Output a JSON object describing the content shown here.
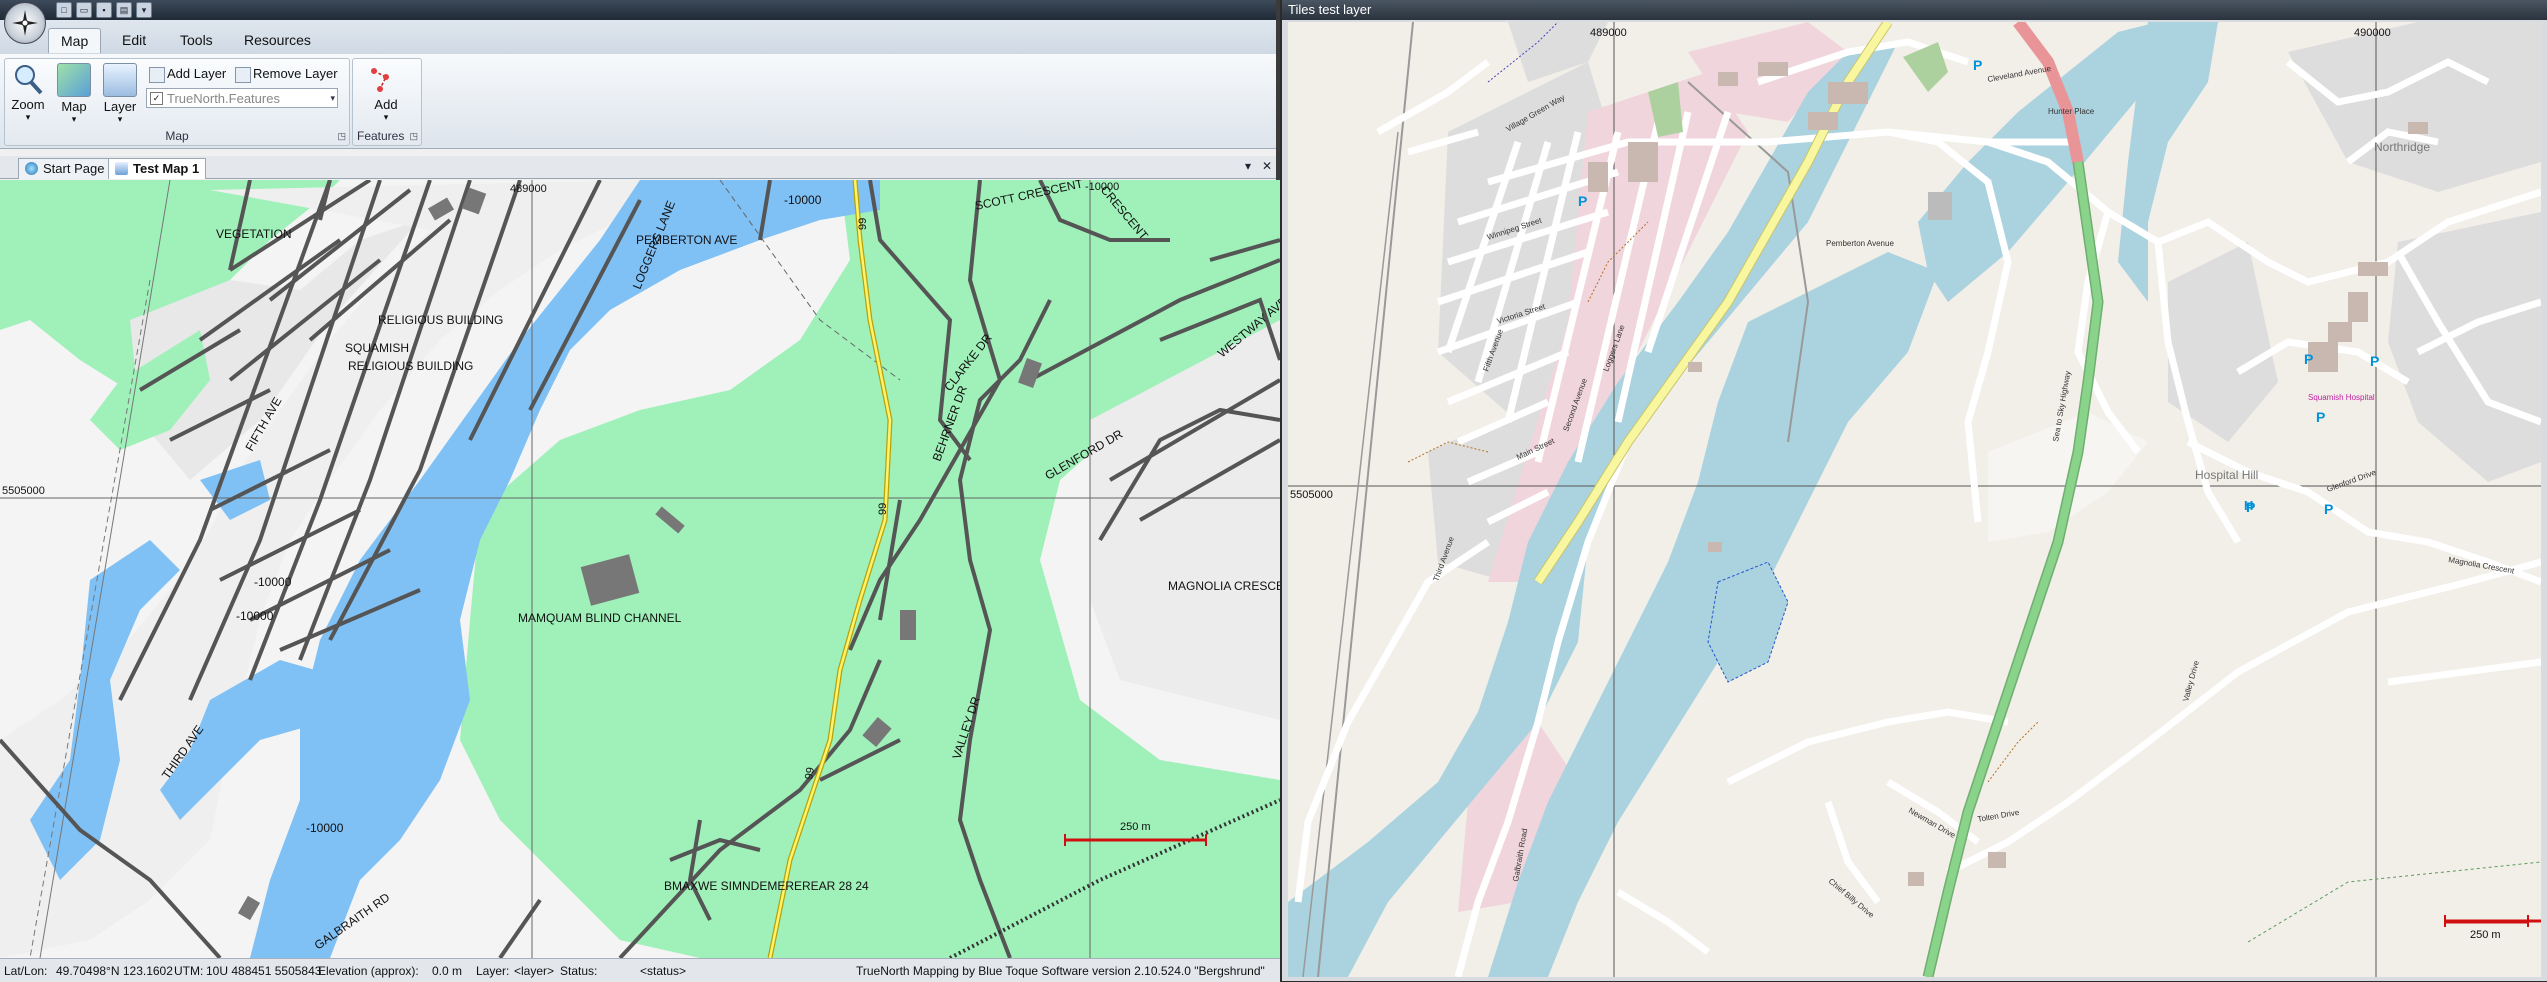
{
  "left_window": {
    "ribbon_tabs": [
      "Map",
      "Edit",
      "Tools",
      "Resources"
    ],
    "map_group": {
      "zoom_label": "Zoom",
      "map_label": "Map",
      "layer_label": "Layer",
      "add_layer_label": "Add Layer",
      "remove_layer_label": "Remove Layer",
      "layer_combo_value": "TrueNorth.Features",
      "group_label": "Map"
    },
    "features_group": {
      "add_label": "Add",
      "group_label": "Features"
    },
    "doc_tabs": [
      "Start Page",
      "Test Map 1"
    ],
    "map": {
      "labels": {
        "vegetation": "VEGETATION",
        "religious_building_1": "RELIGIOUS BUILDING",
        "squamish": "SQUAMISH",
        "religious_building_2": "RELIGIOUS BUILDING",
        "pemberton_ave": "PEMBERTON AVE",
        "loggers_lane": "LOGGERS LANE",
        "scott_crescent": "SCOTT CRESCENT",
        "crescent": "CRESCENT",
        "clarke": "CLARKE DR",
        "behrner": "BEHRNER DR",
        "glenford": "GLENFORD DR",
        "westway": "WESTWAY AVE",
        "magnolia": "MAGNOLIA CRESCE",
        "mamquam": "MAMQUAM BLIND CHANNEL",
        "valley": "VALLEY DR",
        "fifth_ave": "FIFTH AVE",
        "third_ave": "THIRD AVE",
        "galbraith": "GALBRAITH RD",
        "highway_99": "99",
        "bottom_overlap": "BMAXWE SIMNDEMEREREAR 28 24",
        "depth_1": "-10000",
        "depth_2": "-10000",
        "depth_3": "-10000",
        "depth_4": "-10000",
        "depth_5": "-10000",
        "grid_x": "489000",
        "grid_y": "5505000",
        "grid_x2": "490000",
        "scale": "250 m"
      }
    },
    "status": {
      "latlon_label": "Lat/Lon:",
      "latlon_value": "49.70498°N 123.1602",
      "utm_label": "UTM:",
      "utm_value": "10U 488451 5505843",
      "elev_label": "Elevation (approx):",
      "elev_value": "0.0 m",
      "layer_label": "Layer:",
      "layer_value": "<layer>",
      "status_label": "Status:",
      "status_value": "<status>",
      "version": "TrueNorth Mapping by Blue Toque Software version 2.10.524.0 \"Bergshrund\""
    }
  },
  "right_window": {
    "title": "Tiles test layer",
    "map": {
      "grid_x1": "489000",
      "grid_x2": "490000",
      "grid_y": "5505000",
      "scale": "250 m",
      "labels": {
        "northridge": "Northridge",
        "hospital_hill": "Hospital Hill",
        "hospital": "Squamish Hospital",
        "pemberton_ave": "Pemberton Avenue",
        "winnipeg": "Winnipeg Street",
        "victoria": "Victoria Street",
        "main": "Main Street",
        "second": "Second Avenue",
        "third": "Third Avenue",
        "fifth": "Fifth Avenue",
        "loggers": "Loggers Lane",
        "cleveland": "Cleveland Avenue",
        "hunter": "Hunter Place",
        "highway": "Sea to Sky Highway",
        "valley": "Valley Drive",
        "galbraith": "Galbraith Road",
        "newman": "Newman Drive",
        "tolten": "Tolten Drive",
        "chief_billy": "Chief Billy Drive",
        "magnolia": "Magnolia Crescent",
        "glenford": "Glenford Drive",
        "village_green": "Village Green Way",
        "parking": "P",
        "helipad": "H"
      }
    }
  },
  "colors": {
    "vegetation": "#9ff0b9",
    "water": "#7fc0f5",
    "osm_water": "#aad3df",
    "osm_land": "#f2efe9",
    "osm_commercial": "#f1d5dc",
    "osm_highway": "#8ad38a",
    "osm_primary": "#f8f79f",
    "osm_trunk": "#e99597",
    "scale": "#d01010"
  }
}
